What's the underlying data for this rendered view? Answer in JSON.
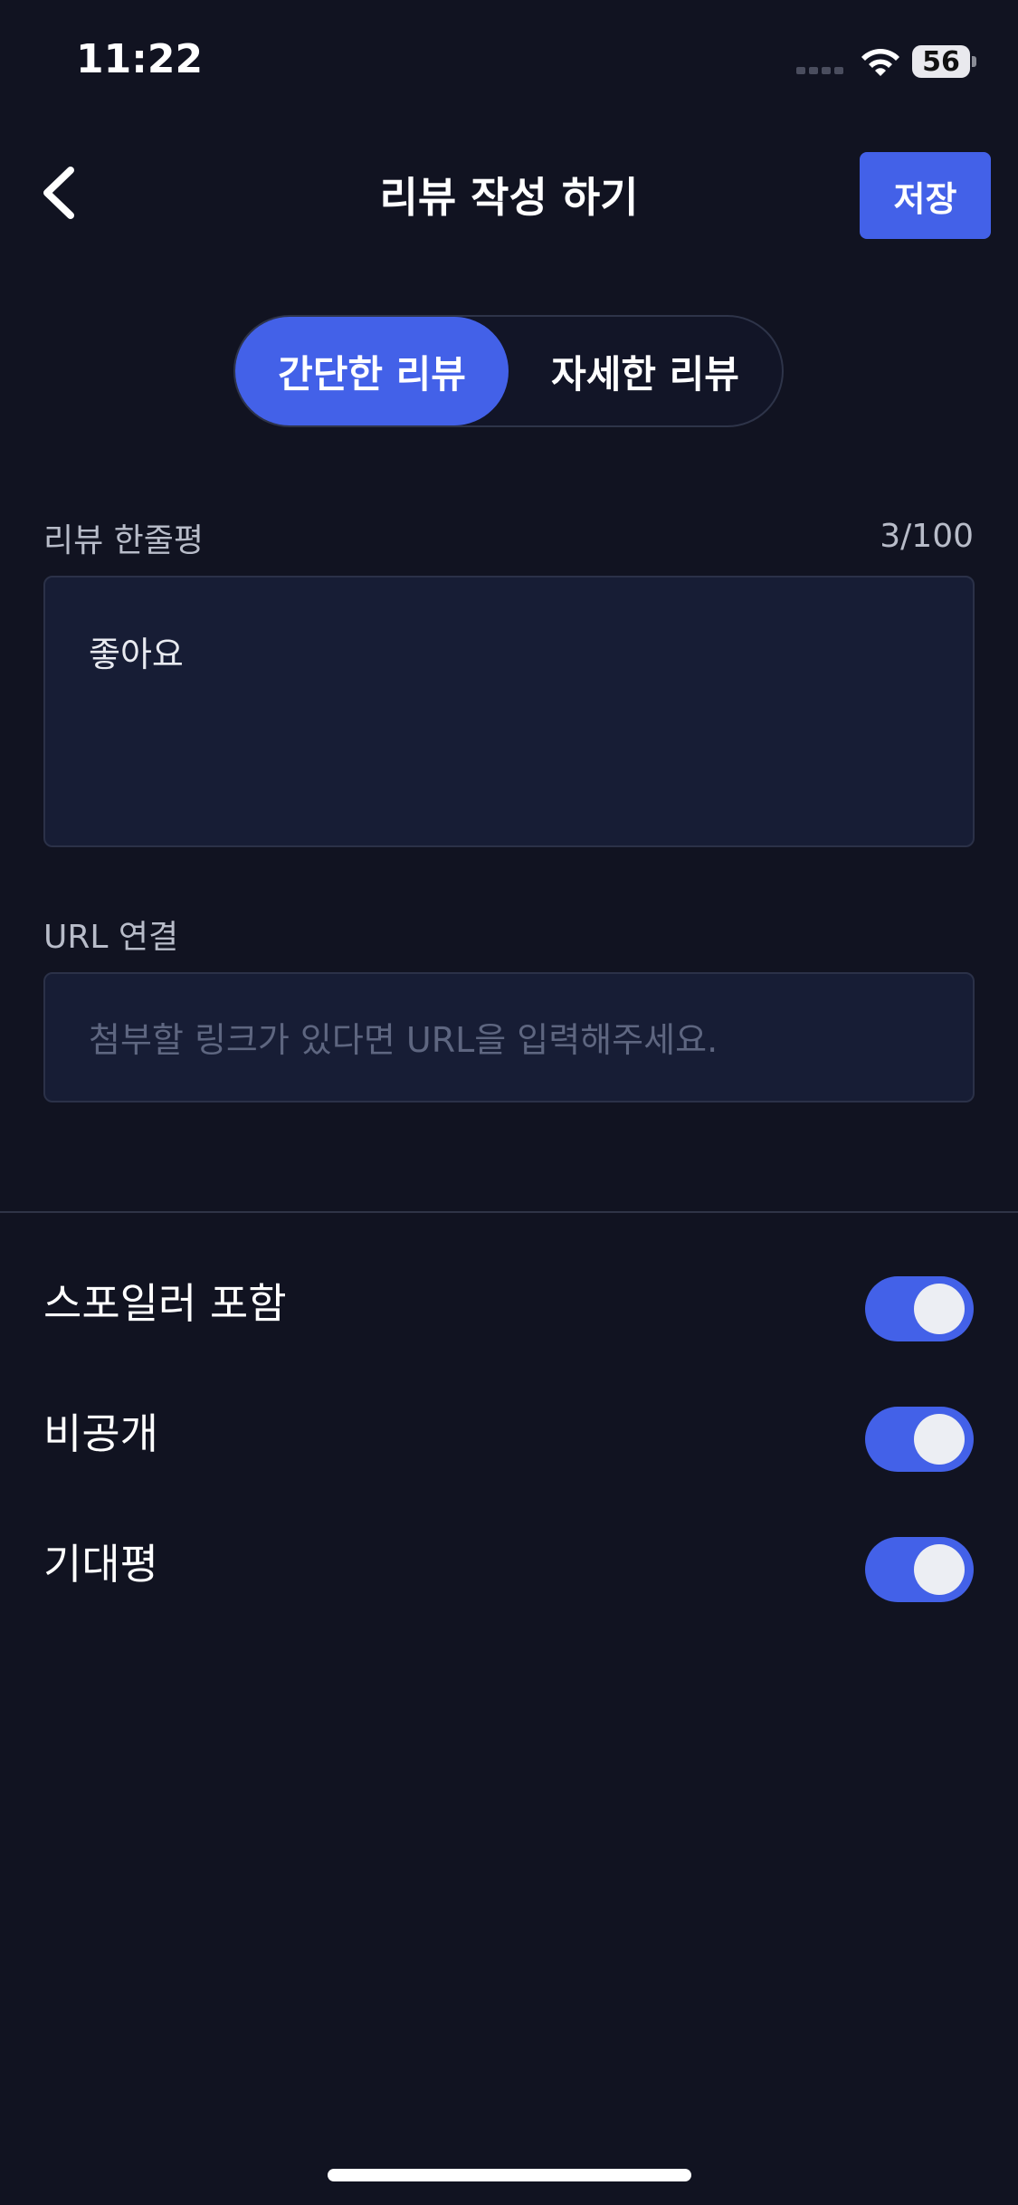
{
  "status_bar": {
    "time": "11:22",
    "battery": "56"
  },
  "header": {
    "title": "리뷰 작성 하기",
    "save_label": "저장"
  },
  "segments": {
    "simple": "간단한 리뷰",
    "detailed": "자세한 리뷰",
    "selected": "간단한 리뷰"
  },
  "review": {
    "label": "리뷰 한줄평",
    "counter": "3/100",
    "value": "좋아요"
  },
  "url": {
    "label": "URL 연결",
    "placeholder": "첨부할 링크가 있다면 URL을 입력해주세요."
  },
  "toggles": [
    {
      "label": "스포일러 포함",
      "on": true
    },
    {
      "label": "비공개",
      "on": true
    },
    {
      "label": "기대평",
      "on": true
    }
  ],
  "colors": {
    "background": "#111321",
    "accent": "#4361e8",
    "field_bg": "#171d35"
  }
}
